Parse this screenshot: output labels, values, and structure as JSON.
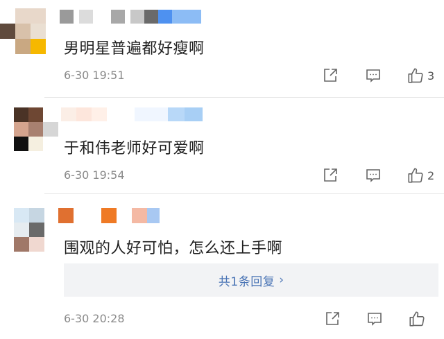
{
  "comments": [
    {
      "text": "男明星普遍都好瘦啊",
      "time": "6-30 19:51",
      "likes": "3",
      "avatar_colors": [
        "#e8d8ca",
        "#d8c1aa",
        "#5f4a3d",
        "#eadfd2",
        "#c9a882",
        "#f6b800"
      ],
      "name_colors": [
        "#9a9a9a",
        "#dcdcdc",
        "#c8c8c8",
        "#ffffff",
        "#a8a8a8",
        "#6a6a6a",
        "#4e91f0",
        "#8cbcf5"
      ]
    },
    {
      "text": "于和伟老师好可爱啊",
      "time": "6-30 19:54",
      "likes": "2",
      "avatar_colors": [
        "#4a3326",
        "#6e4733",
        "#d4a48e",
        "#a88070",
        "#d6d6d6",
        "#111111",
        "#f5efe0",
        "#ffffff"
      ],
      "name_colors": [
        "#fbeee6",
        "#fde6dc",
        "#fff0e8",
        "#ffffff",
        "#f0f6ff",
        "#b8d8f8",
        "#a8cff5"
      ]
    },
    {
      "text": "围观的人好可怕，怎么还上手啊",
      "time": "6-30 20:28",
      "likes": "",
      "avatar_colors": [
        "#d8e8f4",
        "#c6d6e2",
        "#e6ecf0",
        "#6a6a6a",
        "#a07868",
        "#f0d8d0"
      ],
      "name_colors": [
        "#e07030",
        "#ffffff",
        "#ef7a25",
        "#f4b9a4",
        "#a8c8f2"
      ],
      "reply_link": "共1条回复",
      "reply_chevron": "›"
    }
  ]
}
